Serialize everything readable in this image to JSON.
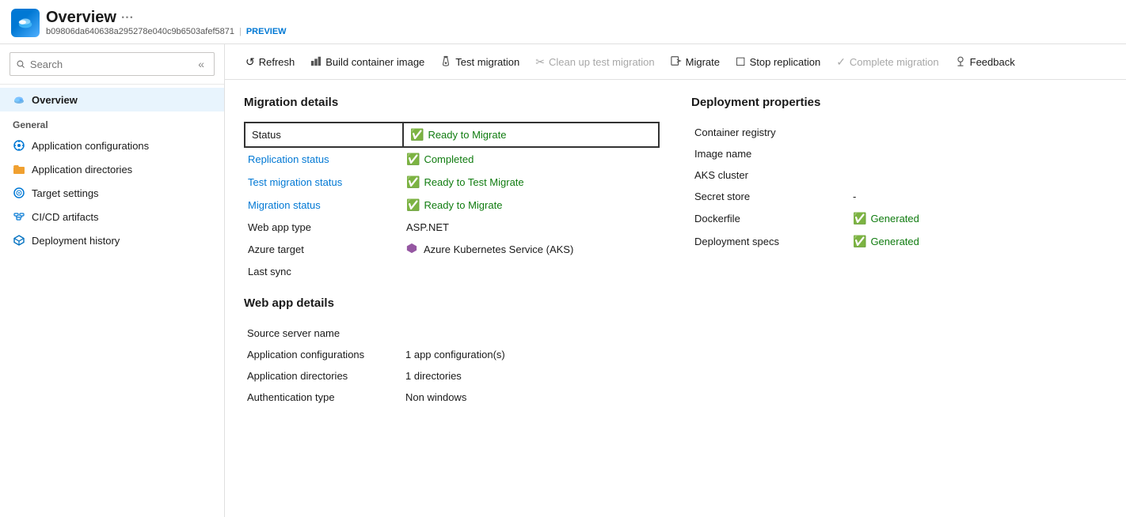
{
  "header": {
    "title": "Overview",
    "dots": "···",
    "subtitle": "b09806da640638a295278e040c9b6503afef5871",
    "separator": "|",
    "preview": "PREVIEW"
  },
  "search": {
    "placeholder": "Search"
  },
  "collapse_icon": "«",
  "sidebar": {
    "general_label": "General",
    "items": [
      {
        "id": "overview",
        "label": "Overview",
        "active": true,
        "icon": "cloud"
      },
      {
        "id": "app-config",
        "label": "Application configurations",
        "active": false,
        "icon": "settings"
      },
      {
        "id": "app-dir",
        "label": "Application directories",
        "active": false,
        "icon": "folder"
      },
      {
        "id": "target",
        "label": "Target settings",
        "active": false,
        "icon": "target"
      },
      {
        "id": "cicd",
        "label": "CI/CD artifacts",
        "active": false,
        "icon": "cicd"
      },
      {
        "id": "deploy",
        "label": "Deployment history",
        "active": false,
        "icon": "cube"
      }
    ]
  },
  "toolbar": {
    "buttons": [
      {
        "id": "refresh",
        "label": "Refresh",
        "icon": "↺",
        "disabled": false
      },
      {
        "id": "build-container",
        "label": "Build container image",
        "icon": "🏗",
        "disabled": false
      },
      {
        "id": "test-migration",
        "label": "Test migration",
        "icon": "🧪",
        "disabled": false
      },
      {
        "id": "cleanup",
        "label": "Clean up test migration",
        "icon": "✂",
        "disabled": true
      },
      {
        "id": "migrate",
        "label": "Migrate",
        "icon": "⎋",
        "disabled": false
      },
      {
        "id": "stop-replication",
        "label": "Stop replication",
        "icon": "☐",
        "disabled": false
      },
      {
        "id": "complete-migration",
        "label": "Complete migration",
        "icon": "✓",
        "disabled": true
      },
      {
        "id": "feedback",
        "label": "Feedback",
        "icon": "👤",
        "disabled": false
      }
    ]
  },
  "migration_details": {
    "title": "Migration details",
    "rows": [
      {
        "id": "status",
        "label": "Status",
        "value": "Ready to Migrate",
        "type": "status-green",
        "highlighted": true
      },
      {
        "id": "replication-status",
        "label": "Replication status",
        "value": "Completed",
        "type": "status-green",
        "link": true
      },
      {
        "id": "test-migration-status",
        "label": "Test migration status",
        "value": "Ready to Test Migrate",
        "type": "status-green",
        "link": true
      },
      {
        "id": "migration-status",
        "label": "Migration status",
        "value": "Ready to Migrate",
        "type": "status-green",
        "link": true
      },
      {
        "id": "web-app-type",
        "label": "Web app type",
        "value": "ASP.NET",
        "type": "plain"
      },
      {
        "id": "azure-target",
        "label": "Azure target",
        "value": "Azure Kubernetes Service (AKS)",
        "type": "aks"
      },
      {
        "id": "last-sync",
        "label": "Last sync",
        "value": "",
        "type": "plain"
      }
    ]
  },
  "web_app_details": {
    "title": "Web app details",
    "rows": [
      {
        "id": "source-server",
        "label": "Source server name",
        "value": ""
      },
      {
        "id": "app-config",
        "label": "Application configurations",
        "value": "1 app configuration(s)"
      },
      {
        "id": "app-dir",
        "label": "Application directories",
        "value": "1 directories"
      },
      {
        "id": "auth-type",
        "label": "Authentication type",
        "value": "Non windows"
      }
    ]
  },
  "deployment_properties": {
    "title": "Deployment properties",
    "rows": [
      {
        "id": "container-registry",
        "label": "Container registry",
        "value": ""
      },
      {
        "id": "image-name",
        "label": "Image name",
        "value": ""
      },
      {
        "id": "aks-cluster",
        "label": "AKS cluster",
        "value": ""
      },
      {
        "id": "secret-store",
        "label": "Secret store",
        "value": "-"
      },
      {
        "id": "dockerfile",
        "label": "Dockerfile",
        "value": "Generated",
        "type": "status-green"
      },
      {
        "id": "deploy-specs",
        "label": "Deployment specs",
        "value": "Generated",
        "type": "status-green"
      }
    ]
  }
}
